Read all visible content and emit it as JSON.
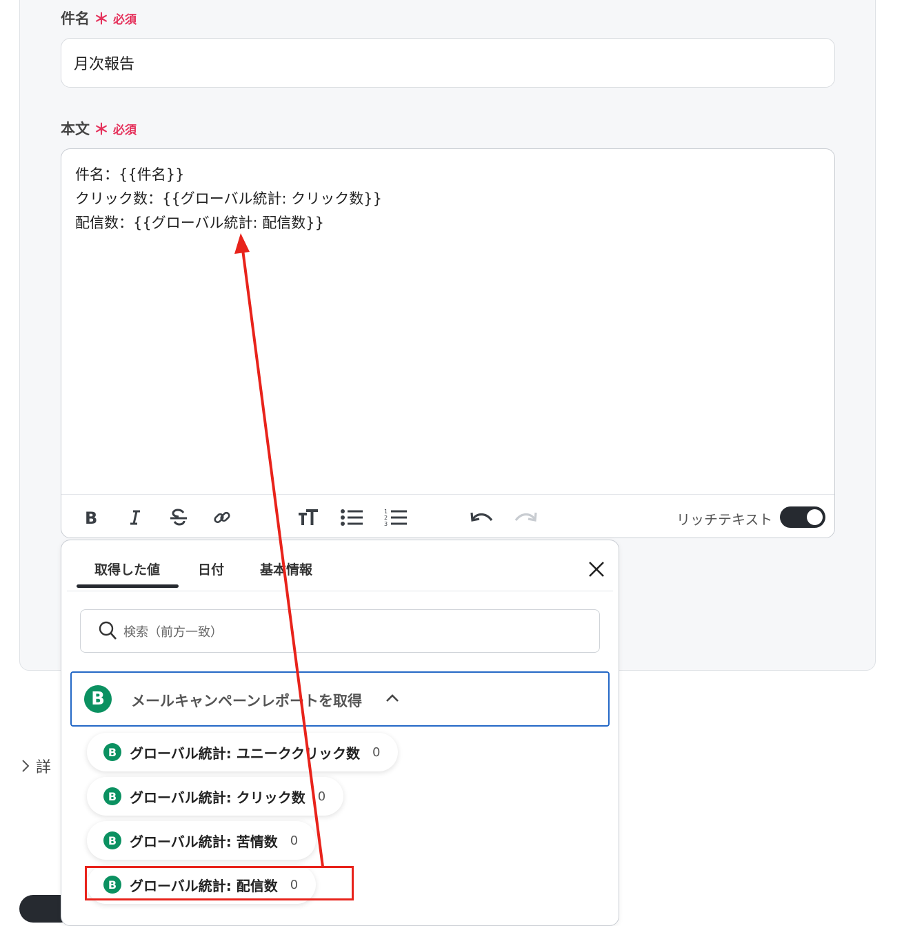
{
  "subject": {
    "label": "件名",
    "required_mark": "＊",
    "required_text": "必須",
    "value": "月次報告"
  },
  "body": {
    "label": "本文",
    "required_mark": "＊",
    "required_text": "必須",
    "lines": [
      "件名：{{件名}}",
      "クリック数：{{グローバル統計: クリック数}}",
      "配信数：{{グローバル統計: 配信数}}"
    ]
  },
  "toolbar": {
    "icons": [
      "bold-icon",
      "italic-icon",
      "strikethrough-icon",
      "link-icon",
      "text-size-icon",
      "bullet-list-icon",
      "numbered-list-icon",
      "undo-icon",
      "redo-icon"
    ],
    "rich_text_label": "リッチテキスト",
    "rich_text_enabled": true
  },
  "details": {
    "label": "詳"
  },
  "popup": {
    "tabs": [
      {
        "label": "取得した値",
        "active": true
      },
      {
        "label": "日付",
        "active": false
      },
      {
        "label": "基本情報",
        "active": false
      }
    ],
    "search_placeholder": "検索（前方一致）",
    "group": {
      "logo_letter": "B",
      "title": "メールキャンペーンレポートを取得",
      "expanded": true
    },
    "items": [
      {
        "label": "グローバル統計: ユニーククリック数",
        "count": "0"
      },
      {
        "label": "グローバル統計: クリック数",
        "count": "0"
      },
      {
        "label": "グローバル統計: 苦情数",
        "count": "0"
      },
      {
        "label": "グローバル統計: 配信数",
        "count": "0",
        "highlighted": true
      }
    ]
  },
  "colors": {
    "required": "#e5315b",
    "brand_green": "#0b9161",
    "focus_blue": "#2468c6",
    "annotation_red": "#e8231b",
    "toggle_dark": "#262a30"
  }
}
